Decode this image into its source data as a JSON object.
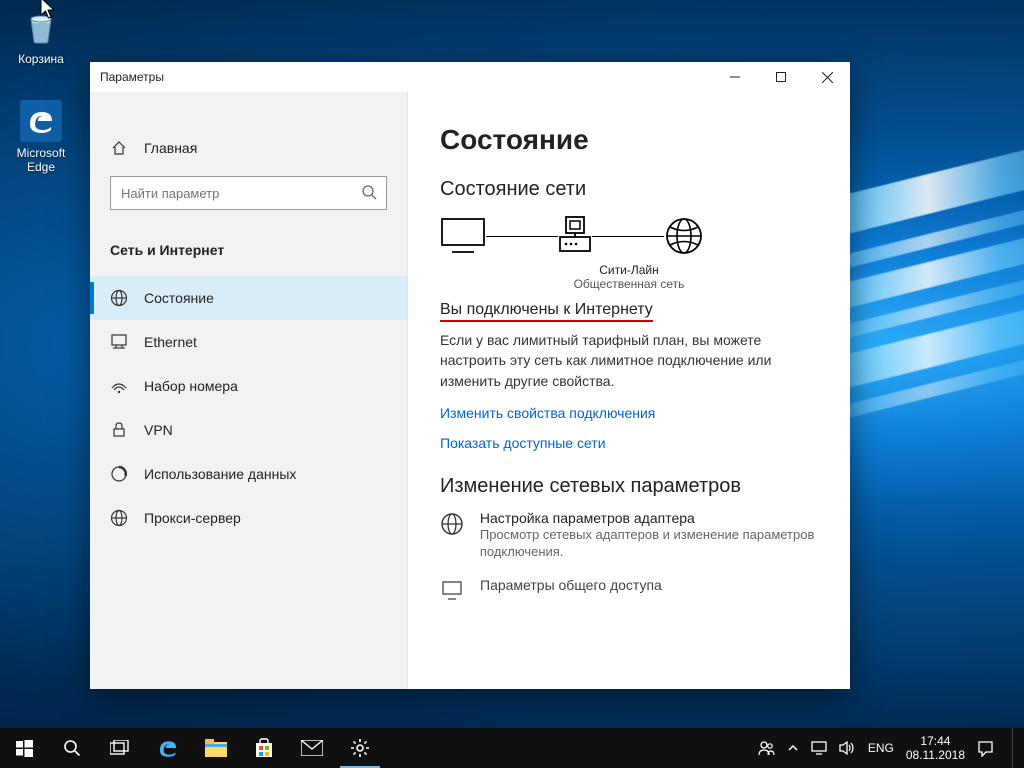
{
  "desktop": {
    "recycle_label": "Корзина",
    "edge_label": "Microsoft Edge"
  },
  "window": {
    "title": "Параметры"
  },
  "sidebar": {
    "home": "Главная",
    "search_placeholder": "Найти параметр",
    "category": "Сеть и Интернет",
    "items": [
      {
        "label": "Состояние"
      },
      {
        "label": "Ethernet"
      },
      {
        "label": "Набор номера"
      },
      {
        "label": "VPN"
      },
      {
        "label": "Использование данных"
      },
      {
        "label": "Прокси-сервер"
      }
    ]
  },
  "main": {
    "page_title": "Состояние",
    "section_network_status": "Состояние сети",
    "diagram": {
      "network_name": "Сити-Лайн",
      "network_type": "Общественная сеть"
    },
    "connected_heading": "Вы подключены к Интернету",
    "connected_body": "Если у вас лимитный тарифный план, вы можете настроить эту сеть как лимитное подключение или изменить другие свойства.",
    "link_change_props": "Изменить свойства подключения",
    "link_show_nets": "Показать доступные сети",
    "section_change_settings": "Изменение сетевых параметров",
    "adapter_title": "Настройка параметров адаптера",
    "adapter_sub": "Просмотр сетевых адаптеров и изменение параметров подключения.",
    "sharing_title": "Параметры общего доступа"
  },
  "taskbar": {
    "lang": "ENG",
    "time": "17:44",
    "date": "08.11.2018"
  }
}
